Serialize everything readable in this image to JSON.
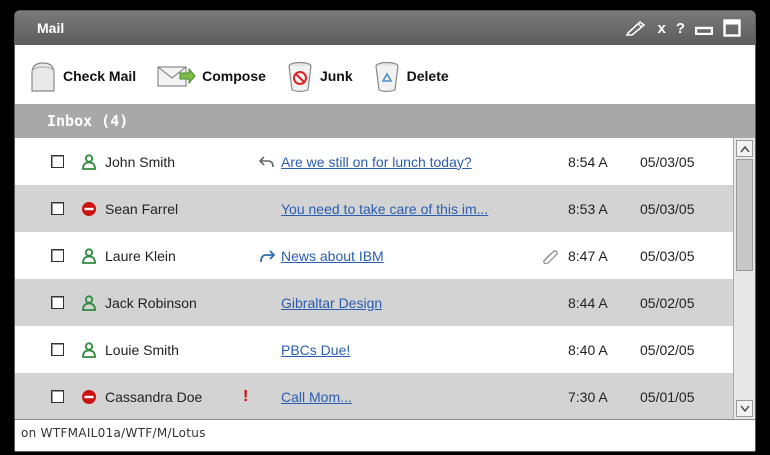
{
  "window": {
    "title": "Mail",
    "controls": [
      "pencil-icon",
      "close-icon",
      "help-icon",
      "minimize-icon",
      "maximize-icon"
    ],
    "help_label": "?",
    "close_label": "x"
  },
  "toolbar": {
    "check_mail": "Check Mail",
    "compose": "Compose",
    "junk": "Junk",
    "delete": "Delete"
  },
  "inbox": {
    "title": "Inbox (4)"
  },
  "messages": [
    {
      "sender": "John Smith",
      "status": "person-icon",
      "action": "reply-icon",
      "subject": "Are we still on for lunch today?",
      "time": "8:54 A",
      "date": "05/03/05",
      "flag": "",
      "attachment": false
    },
    {
      "sender": "Sean Farrel",
      "status": "blocked-icon",
      "action": "",
      "subject": "You need to take care of this im...",
      "time": "8:53 A",
      "date": "05/03/05",
      "flag": "",
      "attachment": false
    },
    {
      "sender": "Laure Klein",
      "status": "person-icon",
      "action": "forward-icon",
      "subject": "News about IBM",
      "time": "8:47 A",
      "date": "05/03/05",
      "flag": "",
      "attachment": true
    },
    {
      "sender": "Jack Robinson",
      "status": "person-icon",
      "action": "",
      "subject": "Gibraltar Design",
      "time": "8:44 A",
      "date": "05/02/05",
      "flag": "",
      "attachment": false
    },
    {
      "sender": "Louie Smith",
      "status": "person-icon",
      "action": "",
      "subject": "PBCs Due!",
      "time": "8:40 A",
      "date": "05/02/05",
      "flag": "",
      "attachment": false
    },
    {
      "sender": "Cassandra Doe",
      "status": "blocked-icon",
      "action": "",
      "subject": "Call Mom...",
      "time": "7:30 A",
      "date": "05/01/05",
      "flag": "!",
      "attachment": false
    }
  ],
  "statusbar": {
    "text": "on WTFMAIL01a/WTF/M/Lotus"
  },
  "colors": {
    "titlebar": "#666666",
    "inbox_header": "#a8a8a8",
    "alt_row": "#d3d3d3",
    "link": "#2a5db0",
    "person_green": "#2e8b3d",
    "blocked_red": "#cc1111"
  }
}
